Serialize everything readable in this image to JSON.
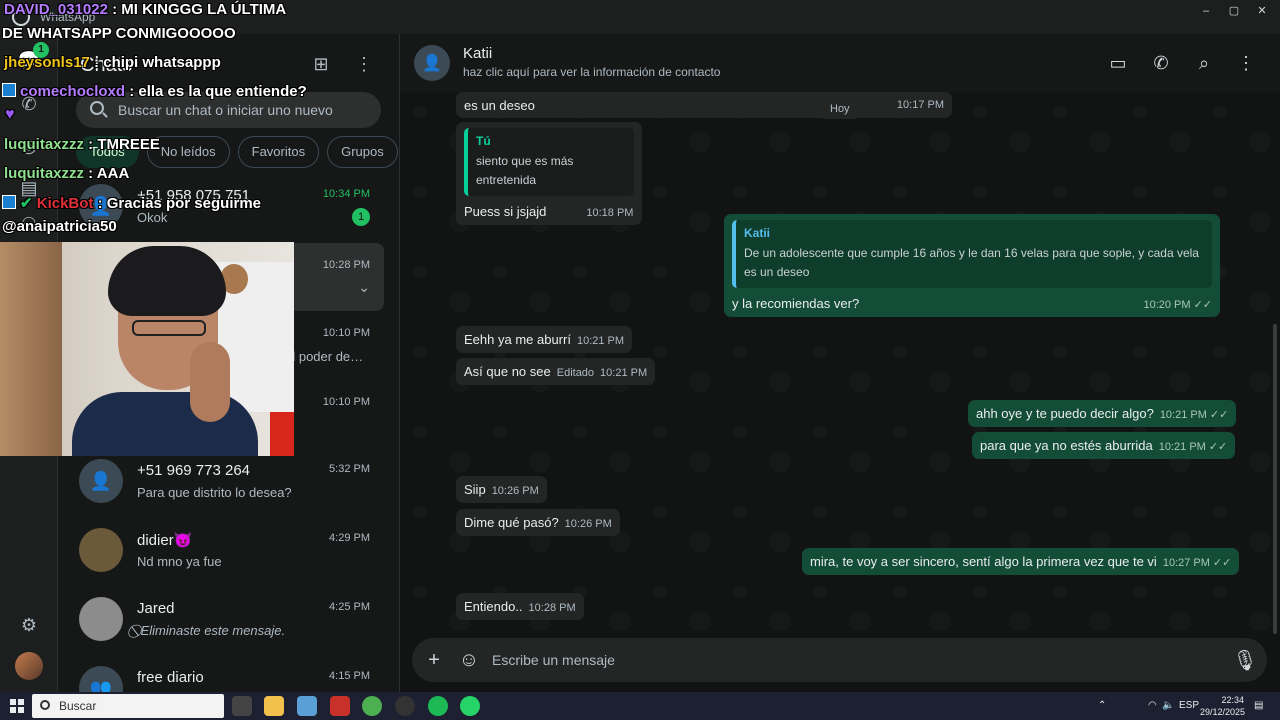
{
  "window": {
    "app_name": "WhatsApp",
    "controls": [
      "–",
      "▢",
      "✕"
    ]
  },
  "rail": {
    "badge": "1"
  },
  "chatlist": {
    "title": "Chats",
    "search_placeholder": "Buscar un chat o iniciar uno nuevo",
    "filters": [
      "Todos",
      "No leídos",
      "Favoritos",
      "Grupos"
    ],
    "chats": [
      {
        "name": "+51 958 075 751",
        "preview": "Okok",
        "time": "10:34 PM",
        "unread": "1"
      },
      {
        "name": "",
        "preview": "",
        "time": "10:28 PM"
      },
      {
        "name": "",
        "preview": "d poder de…",
        "time": "10:10 PM"
      },
      {
        "name": "",
        "preview": "",
        "time": "10:10 PM"
      },
      {
        "name": "+51 969 773 264",
        "preview": "Para que distrito lo desea?",
        "time": "5:32 PM"
      },
      {
        "name": "didier😈",
        "preview": "Nd mno ya fue",
        "time": "4:29 PM"
      },
      {
        "name": "Jared",
        "preview": "⃠ Eliminaste este mensaje.",
        "time": "4:25 PM"
      },
      {
        "name": "free diario",
        "preview": "",
        "time": "4:15 PM"
      }
    ]
  },
  "conversation": {
    "name": "Katii",
    "subtitle": "haz clic aquí para ver la información de contacto",
    "day_label": "Hoy",
    "messages": [
      {
        "dir": "in",
        "text": "es un deseo",
        "time": "10:17 PM"
      },
      {
        "dir": "in",
        "quote_name": "Tú",
        "quote_text": "siento que es más entretenida",
        "text": "Puess si jsjajd",
        "time": "10:18 PM"
      },
      {
        "dir": "out",
        "quote_name": "Katii",
        "quote_text": "De un adolescente que cumple 16 años y le dan 16 velas para que sople, y cada vela es un deseo",
        "text": "y la recomiendas ver?",
        "time": "10:20 PM"
      },
      {
        "dir": "in",
        "text": "Eehh ya me aburrí",
        "time": "10:21 PM"
      },
      {
        "dir": "in",
        "text": "Así que no see",
        "edited": "Editado",
        "time": "10:21 PM"
      },
      {
        "dir": "out",
        "text": "ahh oye y te puedo decir algo?",
        "time": "10:21 PM"
      },
      {
        "dir": "out",
        "text": "para que ya no estés aburrida",
        "time": "10:21 PM"
      },
      {
        "dir": "in",
        "text": "Siip",
        "time": "10:26 PM"
      },
      {
        "dir": "in",
        "text": "Dime qué pasó?",
        "time": "10:26 PM"
      },
      {
        "dir": "out",
        "text": "mira, te voy a ser sincero, sentí algo la primera vez que te vi",
        "time": "10:27 PM"
      },
      {
        "dir": "in",
        "text": "Entiendo..",
        "time": "10:28 PM"
      }
    ],
    "composer_placeholder": "Escribe un mensaje"
  },
  "overlay": {
    "lines": [
      {
        "user": "DAVID_031022",
        "user_color": "#b57cff",
        "text": " : MI KINGGG LA ÚLTIMA"
      },
      {
        "user": "",
        "text": "DE WHATSAPP CONMIGOOOOO"
      },
      {
        "user": "jheysonls17",
        "user_color": "#f0c419",
        "text": " : chipi whatsappp"
      },
      {
        "user": "comechocloxd",
        "user_color": "#b57cff",
        "text": " : ella es la que entiende?"
      },
      {
        "user": "luquitaxzzz",
        "user_color": "#8fe08f",
        "text": " : TMREEE"
      },
      {
        "user": "luquitaxzzz",
        "user_color": "#8fe08f",
        "text": " : AAA"
      },
      {
        "user": "KickBot",
        "user_color": "#e0303a",
        "text": " : Gracias por seguirme"
      },
      {
        "user": "",
        "text": "@anaipatricia50"
      }
    ]
  },
  "taskbar": {
    "search_label": "Buscar",
    "language": "ESP",
    "time": "22:34",
    "date": "29/12/2025"
  },
  "colors": {
    "accent": "#21c063",
    "outgoing_bubble": "#144d37",
    "incoming_bubble": "#242626"
  }
}
